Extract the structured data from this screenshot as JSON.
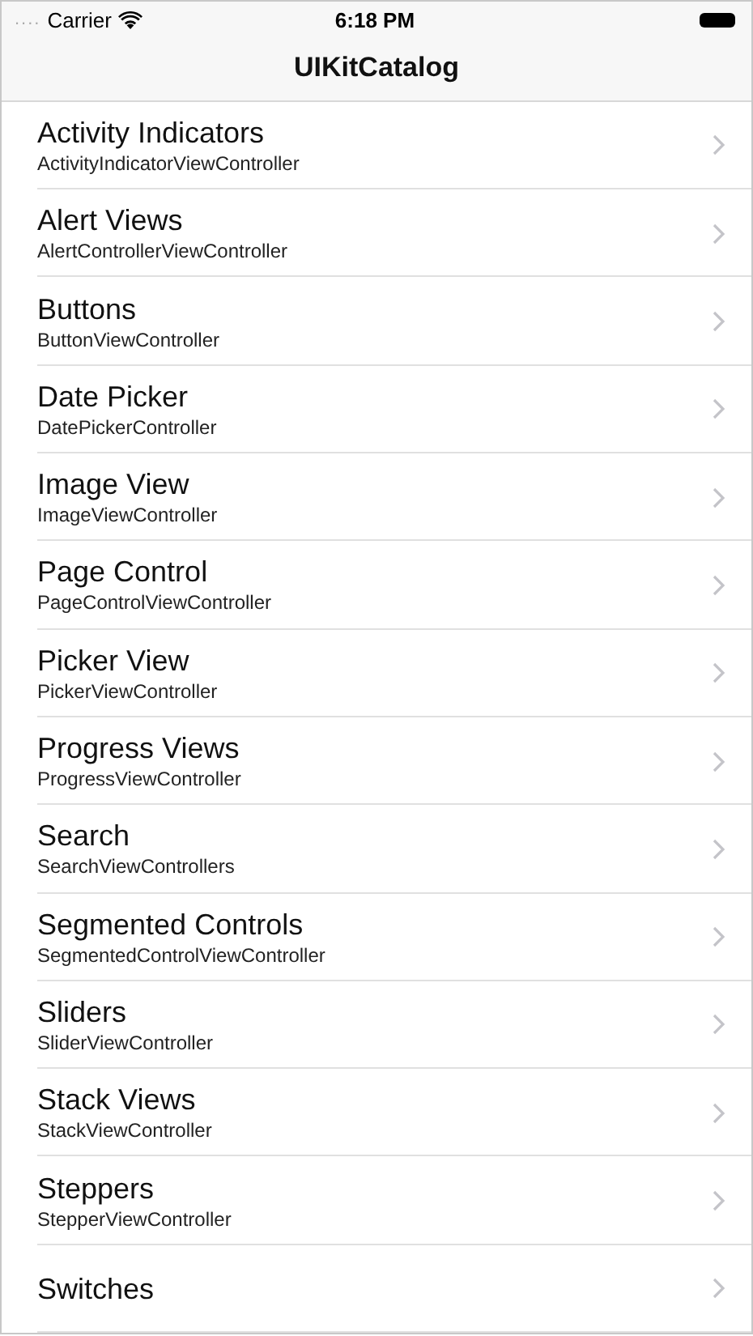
{
  "status_bar": {
    "signal_dots": "....",
    "carrier": "Carrier",
    "time": "6:18 PM"
  },
  "navigation_bar": {
    "title": "UIKitCatalog"
  },
  "rows": [
    {
      "title": "Activity Indicators",
      "subtitle": "ActivityIndicatorViewController"
    },
    {
      "title": "Alert Views",
      "subtitle": "AlertControllerViewController"
    },
    {
      "title": "Buttons",
      "subtitle": "ButtonViewController"
    },
    {
      "title": "Date Picker",
      "subtitle": "DatePickerController"
    },
    {
      "title": "Image View",
      "subtitle": "ImageViewController"
    },
    {
      "title": "Page Control",
      "subtitle": "PageControlViewController"
    },
    {
      "title": "Picker View",
      "subtitle": "PickerViewController"
    },
    {
      "title": "Progress Views",
      "subtitle": "ProgressViewController"
    },
    {
      "title": "Search",
      "subtitle": "SearchViewControllers"
    },
    {
      "title": "Segmented Controls",
      "subtitle": "SegmentedControlViewController"
    },
    {
      "title": "Sliders",
      "subtitle": "SliderViewController"
    },
    {
      "title": "Stack Views",
      "subtitle": "StackViewController"
    },
    {
      "title": "Steppers",
      "subtitle": "StepperViewController"
    },
    {
      "title": "Switches"
    }
  ]
}
